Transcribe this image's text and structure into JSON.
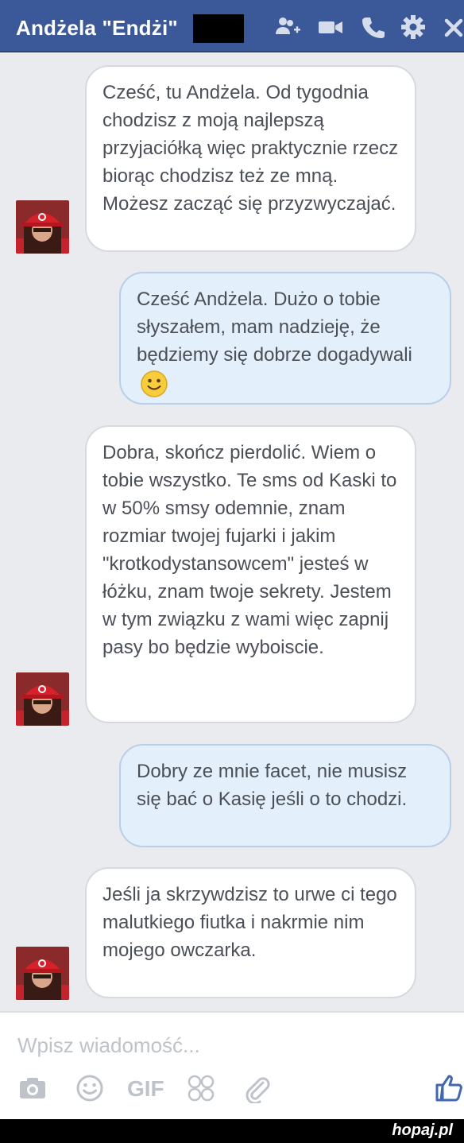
{
  "header": {
    "title": "Andżela \"Endżi\"",
    "icons": [
      "add-people-icon",
      "video-call-icon",
      "phone-icon",
      "gear-icon",
      "close-icon"
    ]
  },
  "messages": [
    {
      "sender": "Andżela",
      "direction": "incoming",
      "text": "Cześć, tu Andżela. Od tygodnia chodzisz z moją najlepszą przyjaciółką więc praktycznie rzecz biorąc chodzisz też ze mną. Możesz zacząć się przyzwyczajać."
    },
    {
      "sender": "me",
      "direction": "outgoing",
      "text": "Cześć Andżela. Dużo o tobie słyszałem, mam nadzieję, że będziemy się dobrze dogadywali",
      "emoji": "smile-emoji"
    },
    {
      "sender": "Andżela",
      "direction": "incoming",
      "text": "Dobra, skończ pierdolić. Wiem o tobie wszystko. Te sms od Kaski to w 50% smsy odemnie, znam rozmiar twojej fujarki i jakim \"krotkodystansowcem\" jesteś w łóżku, znam twoje sekrety. Jestem w tym związku z wami więc zapnij pasy bo będzie wyboiscie."
    },
    {
      "sender": "me",
      "direction": "outgoing",
      "text": "Dobry ze mnie facet, nie musisz się bać o Kasię jeśli o to chodzi."
    },
    {
      "sender": "Andżela",
      "direction": "incoming",
      "text": "Jeśli ja skrzywdzisz to urwe ci tego malutkiego fiutka i nakrmie nim mojego owczarka."
    }
  ],
  "composer": {
    "placeholder": "Wpisz wiadomość...",
    "gif_label": "GIF",
    "tools": [
      "camera-icon",
      "emoji-icon",
      "gif-button",
      "stickers-icon",
      "attachment-icon",
      "like-icon"
    ]
  },
  "watermark": "hopaj.pl",
  "colors": {
    "header": "#3b5998",
    "incoming_bubble": "#ffffff",
    "outgoing_bubble": "#e4effc",
    "background": "#e9ebee"
  }
}
